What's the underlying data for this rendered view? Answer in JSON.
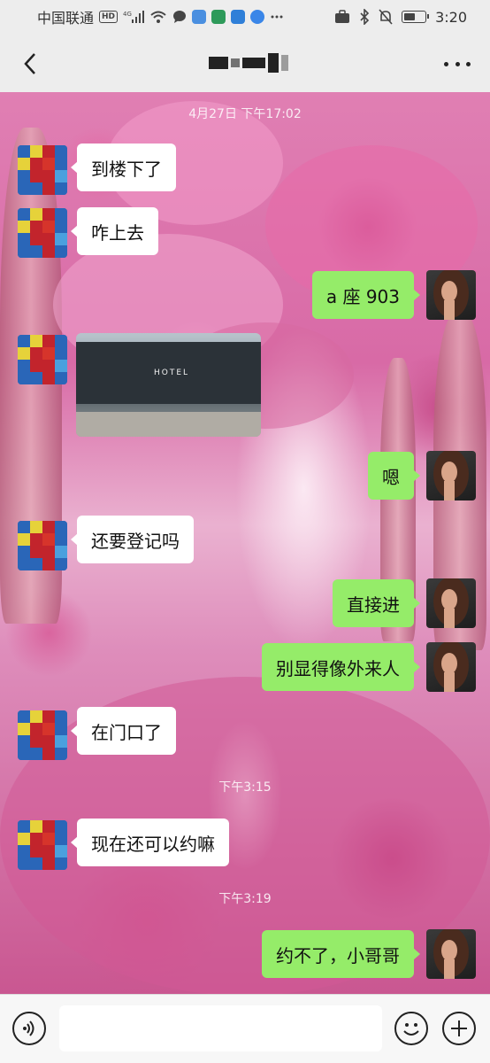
{
  "status_bar": {
    "carrier": "中国联通",
    "network_badge": "HD",
    "signal_label": "4G",
    "time": "3:20",
    "icons": [
      "hd-icon",
      "signal-icon",
      "wifi-icon",
      "message-icon",
      "music-icon",
      "app-icon",
      "cloud-icon",
      "browser-icon",
      "more-dots-icon",
      "briefcase-icon",
      "bluetooth-icon",
      "mute-bell-icon",
      "battery-icon"
    ],
    "battery_level": 0.55
  },
  "header": {
    "back_icon": "chevron-left-icon",
    "more_icon": "more-dots-icon"
  },
  "chat": {
    "timestamps": [
      "4月27日 下午17:02",
      "下午3:15",
      "下午3:19"
    ],
    "messages": [
      {
        "side": "in",
        "type": "text",
        "text": "到楼下了"
      },
      {
        "side": "in",
        "type": "text",
        "text": "咋上去"
      },
      {
        "side": "out",
        "type": "text",
        "text": "a 座 903"
      },
      {
        "side": "in",
        "type": "image",
        "text": "HOTEL"
      },
      {
        "side": "out",
        "type": "text",
        "text": "嗯"
      },
      {
        "side": "in",
        "type": "text",
        "text": "还要登记吗"
      },
      {
        "side": "out",
        "type": "text",
        "text": "直接进"
      },
      {
        "side": "out",
        "type": "text",
        "text": "别显得像外来人"
      },
      {
        "side": "in",
        "type": "text",
        "text": "在门口了"
      },
      {
        "side": "in",
        "type": "text",
        "text": "现在还可以约嘛"
      },
      {
        "side": "out",
        "type": "text",
        "text": "约不了，小哥哥"
      }
    ]
  },
  "input_bar": {
    "placeholder": "",
    "voice_icon": "voice-icon",
    "emoji_icon": "emoji-icon",
    "plus_icon": "plus-icon"
  },
  "colors": {
    "outgoing_bubble": "#95ec69",
    "incoming_bubble": "#ffffff",
    "bar_background": "#ededed"
  }
}
